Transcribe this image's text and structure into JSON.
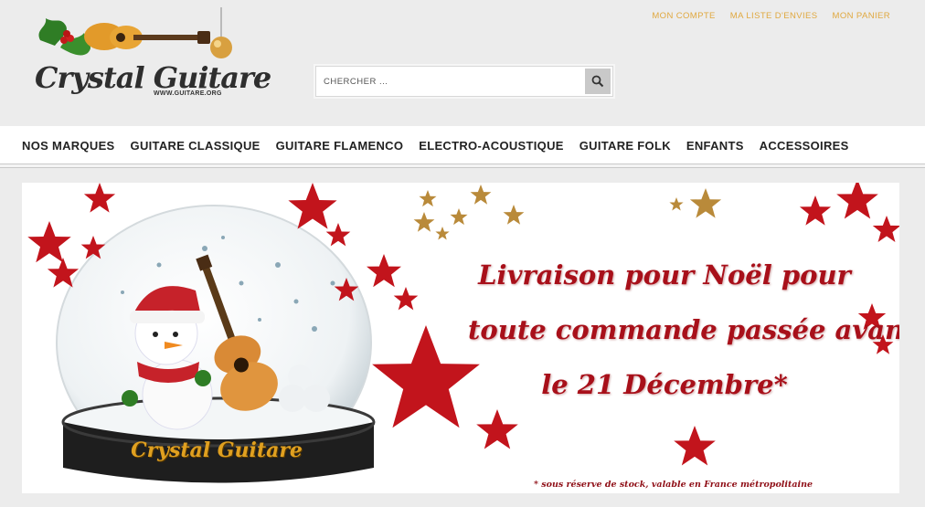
{
  "logo": {
    "name": "Crystal Guitare",
    "url": "WWW.GUITARE.ORG"
  },
  "top_links": [
    "MON COMPTE",
    "MA LISTE D'ENVIES",
    "MON PANIER"
  ],
  "search": {
    "placeholder": "CHERCHER ..."
  },
  "nav": [
    "NOS MARQUES",
    "GUITARE CLASSIQUE",
    "GUITARE FLAMENCO",
    "ELECTRO-ACOUSTIQUE",
    "GUITARE FOLK",
    "ENFANTS",
    "ACCESSOIRES"
  ],
  "banner": {
    "line1": "Livraison pour Noël pour",
    "line2": "toute commande passée avant",
    "line3": "le 21 Décembre*",
    "footnote": "* sous réserve de stock, valable en France métropolitaine",
    "globe_label": "Crystal Guitare",
    "colors": {
      "accent_red": "#c2141c",
      "gold": "#e0a020"
    }
  }
}
